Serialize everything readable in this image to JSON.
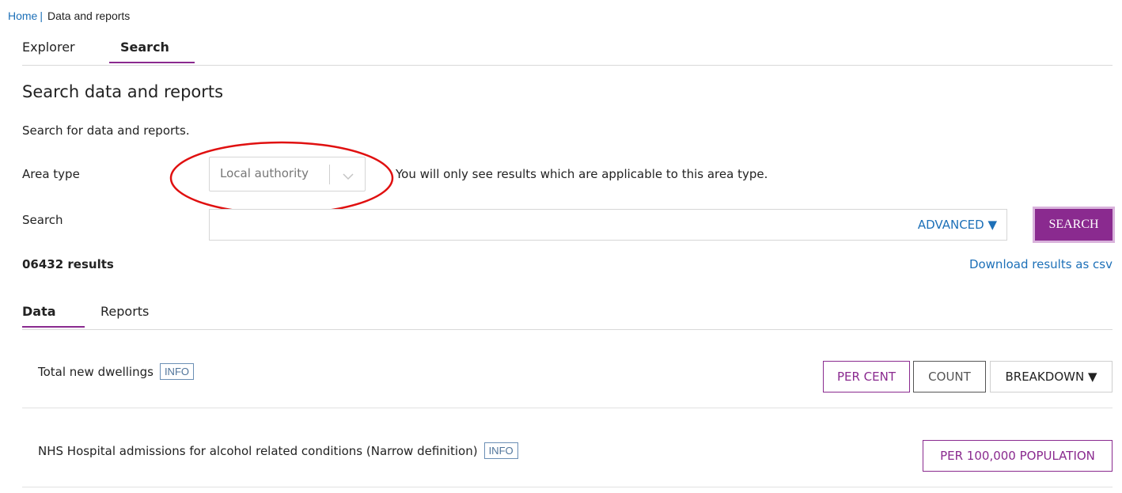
{
  "breadcrumb": {
    "home": "Home",
    "separator": "|",
    "current": "Data and reports"
  },
  "top_tabs": [
    {
      "label": "Explorer"
    },
    {
      "label": "Search"
    }
  ],
  "page": {
    "title": "Search data and reports",
    "description": "Search for data and reports."
  },
  "area_type": {
    "label": "Area type",
    "value": "Local authority",
    "hint": "You will only see results which are applicable to this area type."
  },
  "search": {
    "label": "Search",
    "value": "",
    "advanced_label": "ADVANCED ▼",
    "button_label": "SEARCH"
  },
  "results": {
    "count": "06432 results",
    "download_label": "Download results as csv"
  },
  "result_tabs": [
    {
      "label": "Data"
    },
    {
      "label": "Reports"
    }
  ],
  "rows": [
    {
      "name": "Total new dwellings",
      "info": "INFO",
      "buttons": [
        "PER CENT",
        "COUNT",
        "BREAKDOWN ▼"
      ]
    },
    {
      "name": "NHS Hospital admissions for alcohol related conditions (Narrow definition)",
      "info": "INFO",
      "buttons": [
        "PER 100,000 POPULATION"
      ]
    }
  ],
  "colors": {
    "brand_purple": "#8a2a8f",
    "link_blue": "#1d70b8",
    "annotation_red": "#e01010"
  }
}
